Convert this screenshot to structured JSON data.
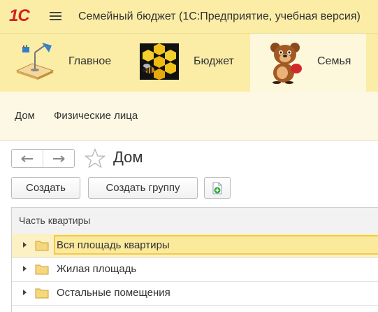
{
  "app": {
    "logo": "1С",
    "title": "Семейный бюджет  (1С:Предприятие, учебная версия)"
  },
  "sections": [
    {
      "label": "Главное",
      "icon": "desk-lamp-icon"
    },
    {
      "label": "Бюджет",
      "icon": "bee-honeycomb-icon"
    },
    {
      "label": "Семья",
      "icon": "bear-icon"
    }
  ],
  "subnav": [
    "Дом",
    "Физические лица"
  ],
  "form": {
    "title": "Дом",
    "create_label": "Создать",
    "create_group_label": "Создать группу"
  },
  "table": {
    "column": "Часть квартиры",
    "rows": [
      {
        "name": "Вся площадь квартиры",
        "selected": true
      },
      {
        "name": "Жилая площадь",
        "selected": false
      },
      {
        "name": "Остальные помещения",
        "selected": false
      }
    ]
  },
  "colors": {
    "accent": "#fbeda6",
    "selection": "#f2c94c",
    "logo": "#d42020"
  }
}
